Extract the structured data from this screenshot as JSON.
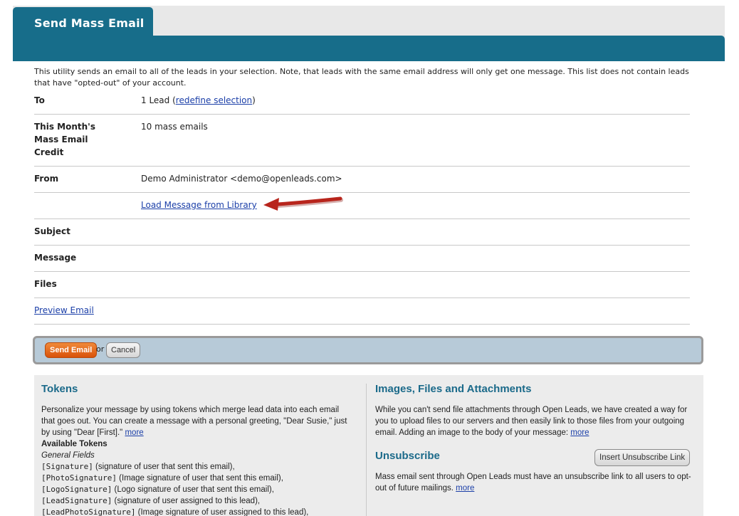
{
  "tab": {
    "title": "Send Mass Email"
  },
  "intro": "This utility sends an email to all of the leads in your selection. Note, that leads with the same email address will only get one message. This list does not contain leads that have \"opted-out\" of your account.",
  "form": {
    "to_label": "To",
    "to_count": "1 Lead (",
    "to_link": "redefine selection",
    "to_close": ")",
    "credit_label": "This Month's Mass Email Credit",
    "credit_value": "10 mass emails",
    "from_label": "From",
    "from_value": "Demo Administrator <demo@openleads.com>",
    "library_link": "Load Message from Library",
    "subject_label": "Subject",
    "message_label": "Message",
    "files_label": "Files",
    "preview_link": "Preview Email"
  },
  "actions": {
    "send_label": "Send Email",
    "or_text": "or",
    "cancel_label": "Cancel"
  },
  "tokens": {
    "heading": "Tokens",
    "description": "Personalize your message by using tokens which merge lead data into each email that goes out. You can create a message with a personal greeting, \"Dear Susie,\" just by using \"Dear [First].\"",
    "more": "more",
    "available_heading": "Available Tokens",
    "general_heading": "General Fields",
    "items": [
      {
        "token": "[Signature]",
        "desc": " (signature of user that sent this email),"
      },
      {
        "token": "[PhotoSignature]",
        "desc": " (Image signature of user that sent this email),"
      },
      {
        "token": "[LogoSignature]",
        "desc": " (Logo signature of user that sent this email),"
      },
      {
        "token": "[LeadSignature]",
        "desc": " (signature of user assigned to this lead),"
      },
      {
        "token": "[LeadPhotoSignature]",
        "desc": " (Image signature of user assigned to this lead),"
      }
    ]
  },
  "images": {
    "heading": "Images, Files and Attachments",
    "description": "While you can't send file attachments through Open Leads, we have created a way for you to upload files to our servers and then easily link to those files from your outgoing email. Adding an image to the body of your message:",
    "more": "more"
  },
  "unsubscribe": {
    "heading": "Unsubscribe",
    "button_label": "Insert Unsubscribe Link",
    "description": "Mass email sent through Open Leads must have an unsubscribe link to all users to opt-out of future mailings.",
    "more": "more"
  },
  "colors": {
    "brand": "#176d8a",
    "heading": "#1b6a8a",
    "send": "#e06414",
    "arrow": "#b8251c"
  }
}
